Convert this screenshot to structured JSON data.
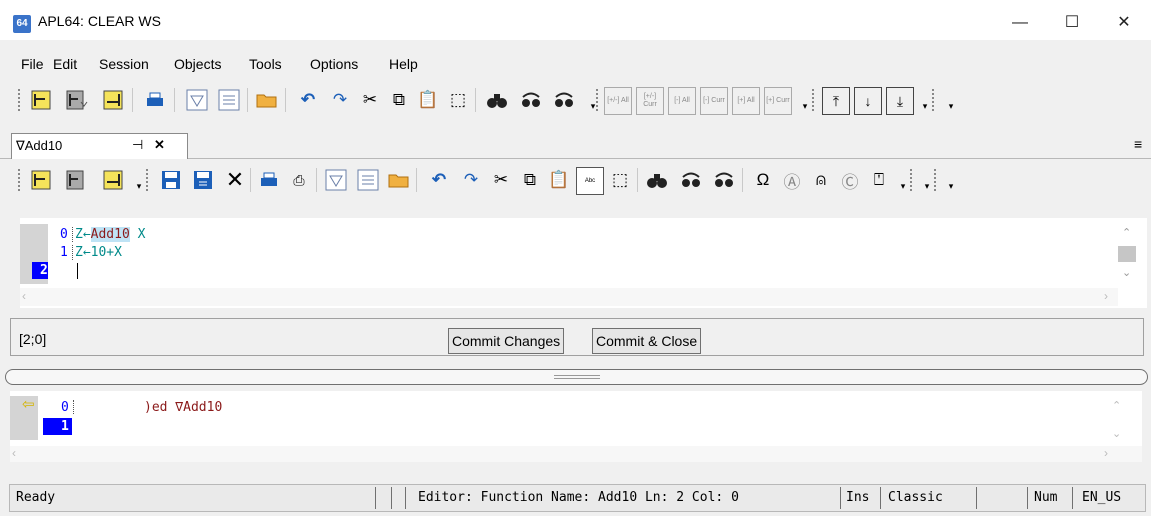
{
  "window": {
    "title": "APL64: CLEAR WS",
    "icon": "64"
  },
  "window_controls": {
    "minimize": "—",
    "maximize": "☐",
    "close": "✕"
  },
  "menu": [
    "File",
    "Edit",
    "Session",
    "Objects",
    "Tools",
    "Options",
    "Help"
  ],
  "main_toolbar": {
    "small_labels": [
      "[+/-] All",
      "[+/-] Curr",
      "[-] All",
      "[-] Curr",
      "[+] All",
      "[+] Curr"
    ]
  },
  "editor_tab": {
    "label": "∇Add10",
    "pin": "⊣",
    "close": "✕"
  },
  "editor": {
    "lines": [
      {
        "num": "0",
        "text_prefix": "Z←",
        "func_name": "Add10",
        "text_suffix": " X"
      },
      {
        "num": "1",
        "text": "Z←10+X"
      },
      {
        "num": "2",
        "text": ""
      }
    ],
    "position": "[2;0]",
    "commit_changes": "Commit Changes",
    "commit_close": "Commit & Close"
  },
  "session": {
    "lines": [
      {
        "num": "0",
        "text": ")ed ∇Add10"
      },
      {
        "num": "1",
        "text": ""
      }
    ]
  },
  "statusbar": {
    "ready": "Ready",
    "editor_info": "Editor: Function Name: Add10 Ln: 2 Col: 0",
    "mode": "Ins",
    "layout": "Classic",
    "num": "Num",
    "locale": "EN_US"
  },
  "colors": {
    "accent_blue": "#0000ff",
    "func_name_bg": "#bfe3f5",
    "session_text": "#8b1a1a",
    "teal_text": "#00808a"
  }
}
